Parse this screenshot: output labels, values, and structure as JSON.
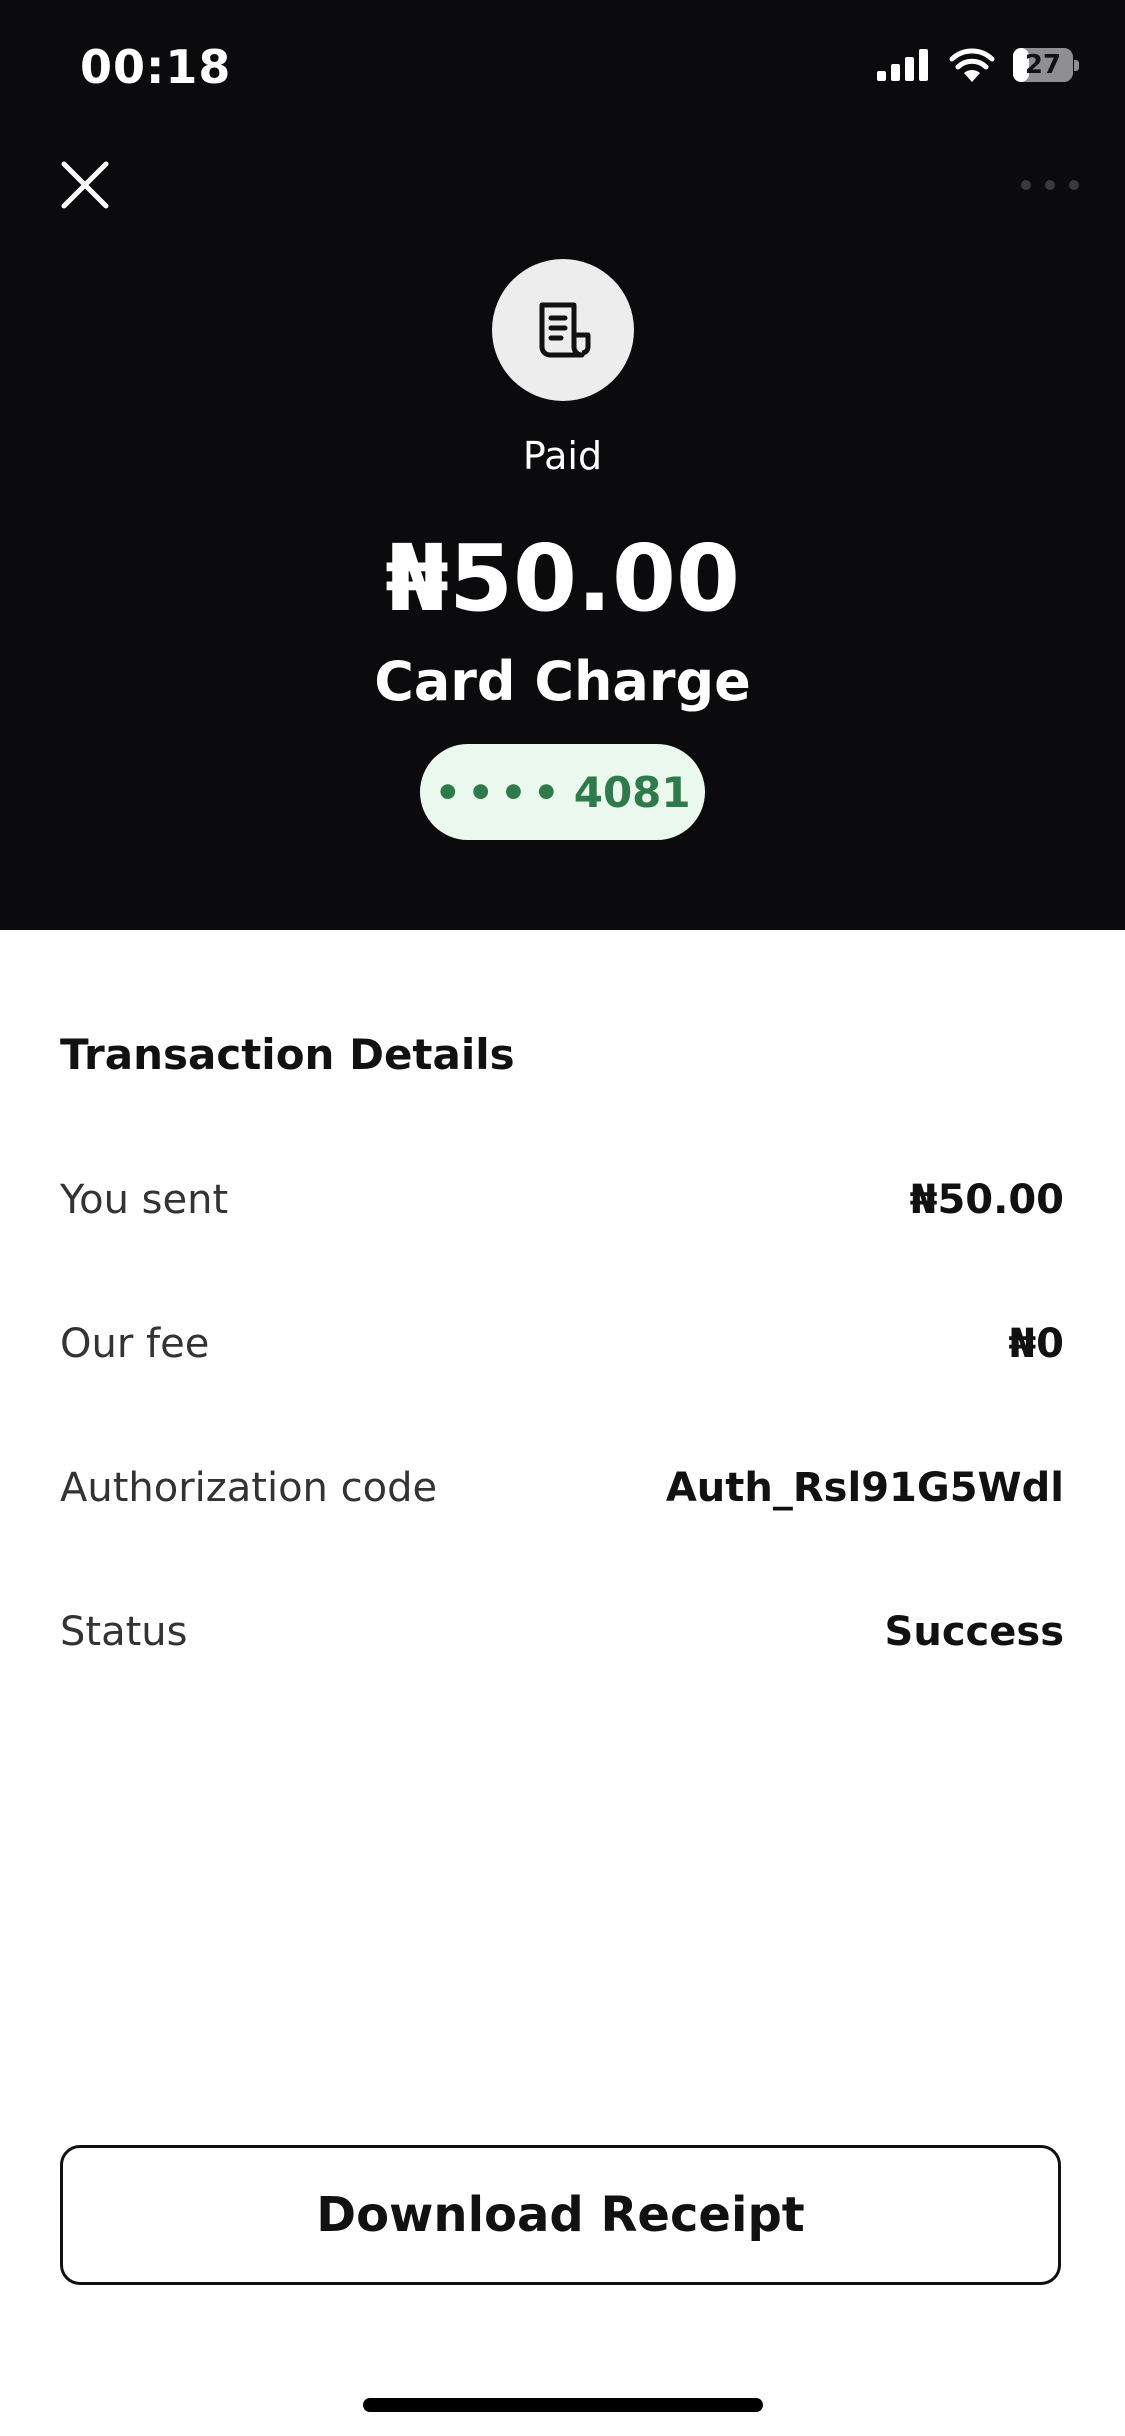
{
  "status_bar": {
    "time": "00:18",
    "battery_percent": 27,
    "battery_label": "27"
  },
  "header": {
    "close_icon": "close-icon",
    "more_icon": "more-dots-icon"
  },
  "transaction": {
    "icon": "receipt-icon",
    "status_label": "Paid",
    "amount": "₦50.00",
    "type": "Card Charge",
    "card_dots": "••••",
    "card_last4": "4081"
  },
  "details": {
    "title": "Transaction Details",
    "rows": [
      {
        "label": "You sent",
        "value": "₦50.00"
      },
      {
        "label": "Our fee",
        "value": "₦0"
      },
      {
        "label": "Authorization code",
        "value": "Auth_Rsl91G5Wdl"
      },
      {
        "label": "Status",
        "value": "Success"
      }
    ]
  },
  "actions": {
    "download_label": "Download Receipt"
  },
  "colors": {
    "header_bg": "#0b0b0d",
    "pill_bg": "#eaf8ee",
    "pill_text": "#2f7a4a"
  }
}
